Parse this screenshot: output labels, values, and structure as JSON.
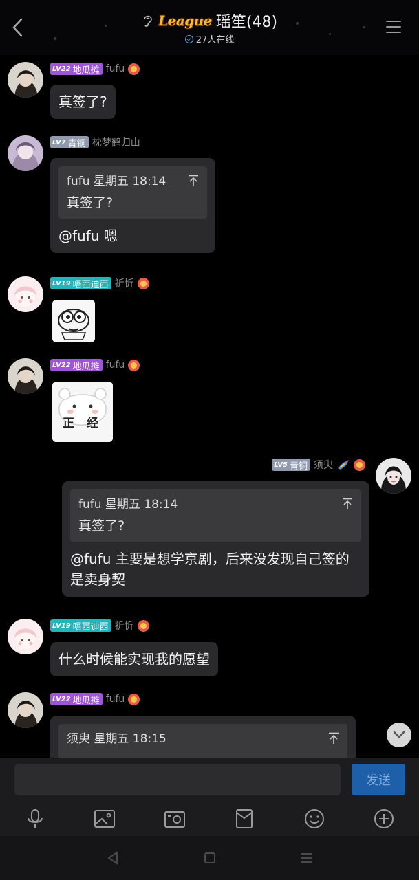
{
  "header": {
    "logo_text": "League",
    "title": "瑶笙(48)",
    "online": "27人在线"
  },
  "messages": [
    {
      "level": "LV22",
      "badge": "地瓜摊",
      "user": "fufu",
      "text": "真签了?"
    },
    {
      "level": "LV7",
      "badge": "青铜",
      "user": "枕梦鹤归山",
      "quote_head": "fufu 星期五 18:14",
      "quote_body": "真签了?",
      "text": "@fufu 嗯"
    },
    {
      "level": "LV19",
      "badge": "唔西迪西",
      "user": "祈忻",
      "sticker": "pepe-face-sticker"
    },
    {
      "level": "LV22",
      "badge": "地瓜摊",
      "user": "fufu",
      "sticker_text": "正 经"
    },
    {
      "level": "LV5",
      "badge": "青铜",
      "user": "须臾",
      "quote_head": "fufu 星期五 18:14",
      "quote_body": "真签了?",
      "text": "@fufu 主要是想学京剧，后来没发现自己签的是卖身契"
    },
    {
      "level": "LV19",
      "badge": "唔西迪西",
      "user": "祈忻",
      "text": "什么时候能实现我的愿望"
    },
    {
      "level": "LV22",
      "badge": "地瓜摊",
      "user": "fufu",
      "quote_head": "须臾 星期五 18:15"
    }
  ],
  "input": {
    "placeholder": "",
    "send_label": "发送"
  },
  "toolbar": [
    "microphone-icon",
    "image-icon",
    "camera-icon",
    "red-packet-icon",
    "emoji-icon",
    "plus-icon"
  ],
  "colors": {
    "badge_purple": "#a055d8",
    "badge_grey": "#8f9aae",
    "badge_teal": "#22b4b8",
    "send": "#1d5fa8",
    "bubble": "#2a2a2c"
  }
}
